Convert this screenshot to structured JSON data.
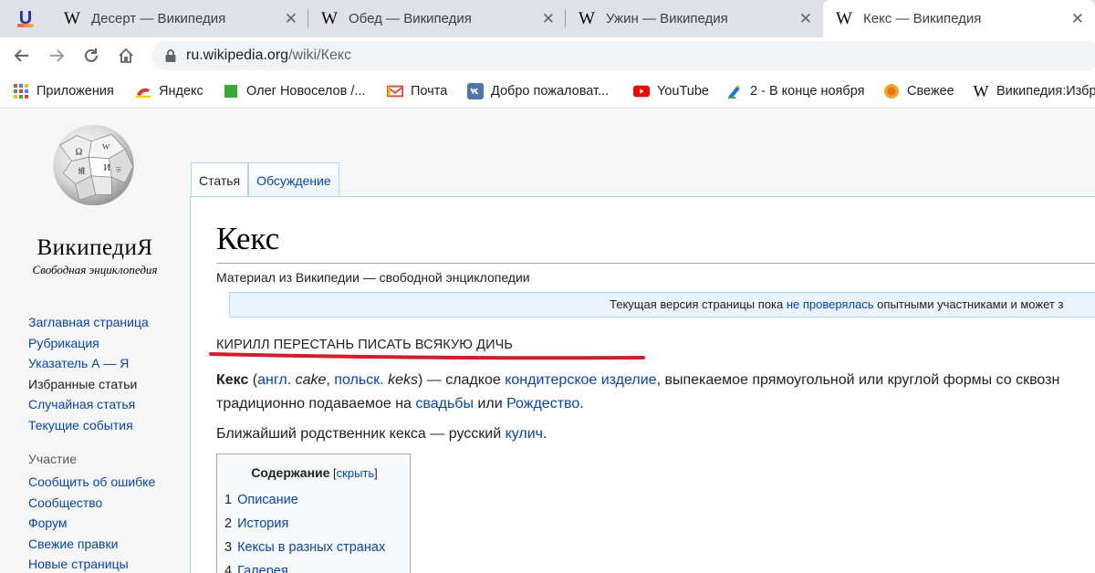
{
  "browser": {
    "extension_letter": "U",
    "tabs": [
      {
        "title": "Десерт — Википедия"
      },
      {
        "title": "Обед — Википедия"
      },
      {
        "title": "Ужин — Википедия"
      },
      {
        "title": "Кекс — Википедия",
        "active": true
      }
    ],
    "favicon_glyph": "W",
    "close_glyph": "✕",
    "url_host": "ru.wikipedia.org",
    "url_path": "/wiki/Кекс",
    "bookmarks": [
      {
        "label": "Приложения",
        "icon": "apps-grid-icon"
      },
      {
        "label": "Яндекс",
        "icon": "yandex-icon"
      },
      {
        "label": "Олег Новоселов /...",
        "icon": "green-square-icon"
      },
      {
        "label": "Почта",
        "icon": "mail-icon"
      },
      {
        "label": "Добро пожаловат...",
        "icon": "vk-icon"
      },
      {
        "label": "YouTube",
        "icon": "youtube-icon"
      },
      {
        "label": "2 - В конце ноября",
        "icon": "document-icon"
      },
      {
        "label": "Свежее",
        "icon": "orange-circle-icon"
      },
      {
        "label": "Википедия:Избр",
        "icon": "wikipedia-icon"
      }
    ]
  },
  "wiki": {
    "wordmark": "ВикипедиЯ",
    "tagline": "Свободная энциклопедия",
    "nav_main": [
      {
        "label": "Заглавная страница"
      },
      {
        "label": "Рубрикация"
      },
      {
        "label": "Указатель А — Я"
      },
      {
        "label": "Избранные статьи",
        "dark": true
      },
      {
        "label": "Случайная статья"
      },
      {
        "label": "Текущие события"
      }
    ],
    "participation_heading": "Участие",
    "nav_participation": [
      {
        "label": "Сообщить об ошибке"
      },
      {
        "label": "Сообщество"
      },
      {
        "label": "Форум"
      },
      {
        "label": "Свежие правки"
      },
      {
        "label": "Новые страницы"
      }
    ],
    "page_tabs": {
      "article": "Статья",
      "talk": "Обсуждение"
    },
    "title": "Кекс",
    "from": "Материал из Википедии — свободной энциклопедии",
    "notice": {
      "before": "Текущая версия страницы пока ",
      "link": "не проверялась",
      "after": " опытными участниками и может з"
    },
    "scribble": "КИРИЛЛ ПЕРЕСТАНЬ ПИСАТЬ ВСЯКУЮ ДИЧЬ",
    "p1": {
      "term": "Кекс",
      "t1": " (",
      "l1": "англ.",
      "t2": " ",
      "i1": "cake",
      "t3": ", ",
      "l2": "польск.",
      "t4": " ",
      "i2": "keks",
      "t5": ") — сладкое ",
      "l3": "кондитерское изделие",
      "t6": ", выпекаемое прямоугольной или круглой формы со сквозн"
    },
    "p1b": {
      "t1": "традиционно подаваемое на ",
      "l1": "свадьбы",
      "t2": " или ",
      "l2": "Рождество",
      "t3": "."
    },
    "p2": {
      "t1": "Ближайший родственник кекса — русский ",
      "l1": "кулич",
      "t2": "."
    },
    "toc": {
      "heading": "Содержание",
      "toggle_open": " [",
      "toggle": "скрыть",
      "toggle_close": "]",
      "items": [
        {
          "num": "1",
          "label": "Описание"
        },
        {
          "num": "2",
          "label": "История"
        },
        {
          "num": "3",
          "label": "Кексы в разных странах"
        },
        {
          "num": "4",
          "label": "Галерея"
        }
      ]
    }
  },
  "colors": {
    "link": "#0645ad",
    "scribble_line": "#d01f2b",
    "tab_strip": "#dee1e6"
  }
}
